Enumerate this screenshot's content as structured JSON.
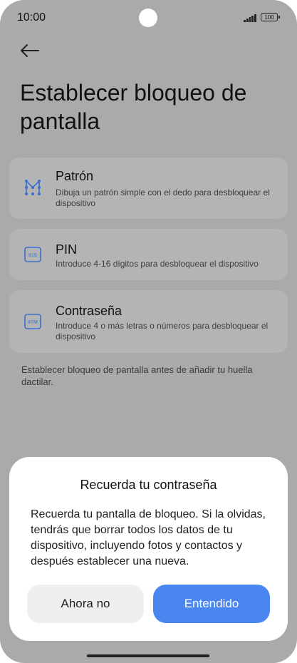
{
  "status_bar": {
    "time": "10:00",
    "battery": "100"
  },
  "page": {
    "title": "Establecer bloqueo de pantalla"
  },
  "options": [
    {
      "title": "Patrón",
      "description": "Dibuja un patrón simple con el dedo para desbloquear el dispositivo",
      "icon": "pattern-icon"
    },
    {
      "title": "PIN",
      "description": "Introduce 4-16 dígitos para desbloquear el dispositivo",
      "icon": "pin-icon",
      "icon_text": "816"
    },
    {
      "title": "Contraseña",
      "description": "Introduce 4 o más letras o números para desbloquear el dispositivo",
      "icon": "password-icon",
      "icon_text": "#7M"
    }
  ],
  "footnote": "Establecer bloqueo de pantalla antes de añadir tu huella dactilar.",
  "dialog": {
    "title": "Recuerda tu contraseña",
    "body": "Recuerda tu pantalla de bloqueo. Si la olvidas, tendrás que borrar todos los datos de tu dispositivo, incluyendo fotos y contactos y después establecer una nueva.",
    "cancel_label": "Ahora no",
    "confirm_label": "Entendido"
  },
  "colors": {
    "accent": "#4a86f0",
    "icon_blue": "#3a6fd0",
    "scrim": "#aaaaaa"
  }
}
